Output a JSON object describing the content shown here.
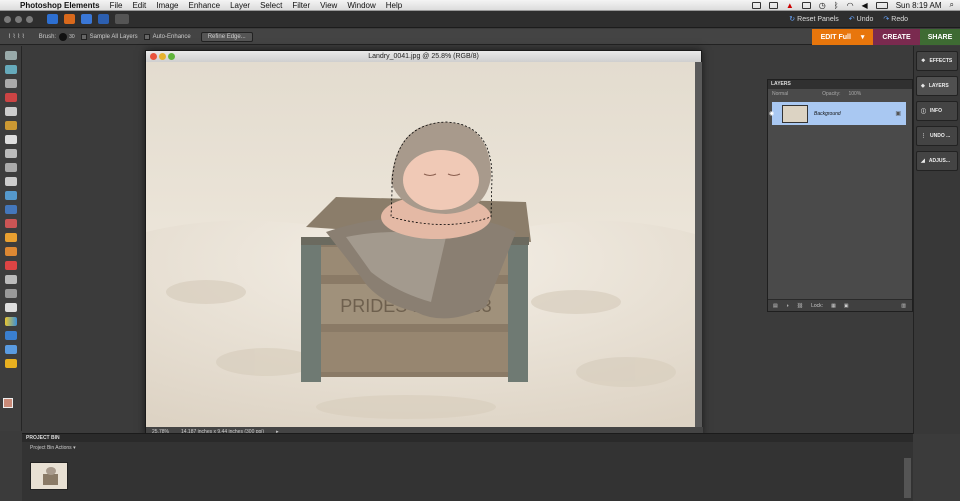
{
  "menubar": {
    "app_name": "Photoshop Elements",
    "items": [
      "File",
      "Edit",
      "Image",
      "Enhance",
      "Layer",
      "Select",
      "Filter",
      "View",
      "Window",
      "Help"
    ],
    "clock": "Sun 8:19 AM"
  },
  "appbar": {
    "reset_panels": "Reset Panels",
    "undo": "Undo",
    "redo": "Redo"
  },
  "tabs": {
    "edit": "EDIT Full",
    "create": "CREATE",
    "share": "SHARE"
  },
  "options": {
    "brush_label": "Brush:",
    "brush_size": "30",
    "sample_all_layers": "Sample All Layers",
    "auto_enhance": "Auto-Enhance",
    "refine_edge": "Refine Edge..."
  },
  "document": {
    "title": "Landry_0041.jpg @ 25.8% (RGB/8)",
    "zoom": "25.78%",
    "size_info": "14.187 inches x 9.44 inches (300 ppi)",
    "crate_text": "PRIDES DAIRY 53"
  },
  "panel_buttons": {
    "effects": "EFFECTS",
    "layers": "LAYERS",
    "info": "INFO",
    "undo": "UNDO ...",
    "adjust": "ADJUS..."
  },
  "layers_panel": {
    "title": "LAYERS",
    "blend_mode": "Normal",
    "opacity_label": "Opacity:",
    "opacity_value": "100%",
    "layer_name": "Background",
    "lock_label": "Lock:"
  },
  "project_bin": {
    "title": "PROJECT BIN",
    "actions": "Project Bin Actions"
  },
  "colors": {
    "edit_tab": "#e8760c",
    "create_tab": "#7a2a4f",
    "share_tab": "#3e6b33",
    "selected_layer": "#a9c8f2"
  }
}
